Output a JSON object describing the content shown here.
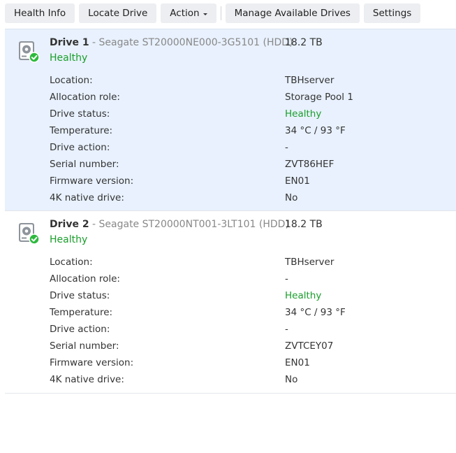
{
  "toolbar": {
    "buttons": [
      {
        "label": "Health Info"
      },
      {
        "label": "Locate Drive"
      },
      {
        "label": "Action"
      },
      {
        "label": "Manage Available Drives"
      },
      {
        "label": "Settings"
      }
    ]
  },
  "colors": {
    "healthy": "#1a9e2b",
    "selected_bg": "#e8f1fd"
  },
  "drives": [
    {
      "name": "Drive 1",
      "model": "- Seagate ST20000NE000-3G5101 (HDD)",
      "size": "18.2 TB",
      "health": "Healthy",
      "icon": "hdd-healthy-icon",
      "details": [
        {
          "label": "Location:",
          "value": "TBHserver"
        },
        {
          "label": "Allocation role:",
          "value": "Storage Pool 1"
        },
        {
          "label": "Drive status:",
          "value": "Healthy"
        },
        {
          "label": "Temperature:",
          "value": "34 °C / 93 °F"
        },
        {
          "label": "Drive action:",
          "value": "-"
        },
        {
          "label": "Serial number:",
          "value": "ZVT86HEF"
        },
        {
          "label": "Firmware version:",
          "value": "EN01"
        },
        {
          "label": "4K native drive:",
          "value": "No"
        }
      ]
    },
    {
      "name": "Drive 2",
      "model": "- Seagate ST20000NT001-3LT101 (HDD)",
      "size": "18.2 TB",
      "health": "Healthy",
      "icon": "hdd-healthy-icon",
      "details": [
        {
          "label": "Location:",
          "value": "TBHserver"
        },
        {
          "label": "Allocation role:",
          "value": "-"
        },
        {
          "label": "Drive status:",
          "value": "Healthy"
        },
        {
          "label": "Temperature:",
          "value": "34 °C / 93 °F"
        },
        {
          "label": "Drive action:",
          "value": "-"
        },
        {
          "label": "Serial number:",
          "value": "ZVTCEY07"
        },
        {
          "label": "Firmware version:",
          "value": "EN01"
        },
        {
          "label": "4K native drive:",
          "value": "No"
        }
      ]
    }
  ]
}
